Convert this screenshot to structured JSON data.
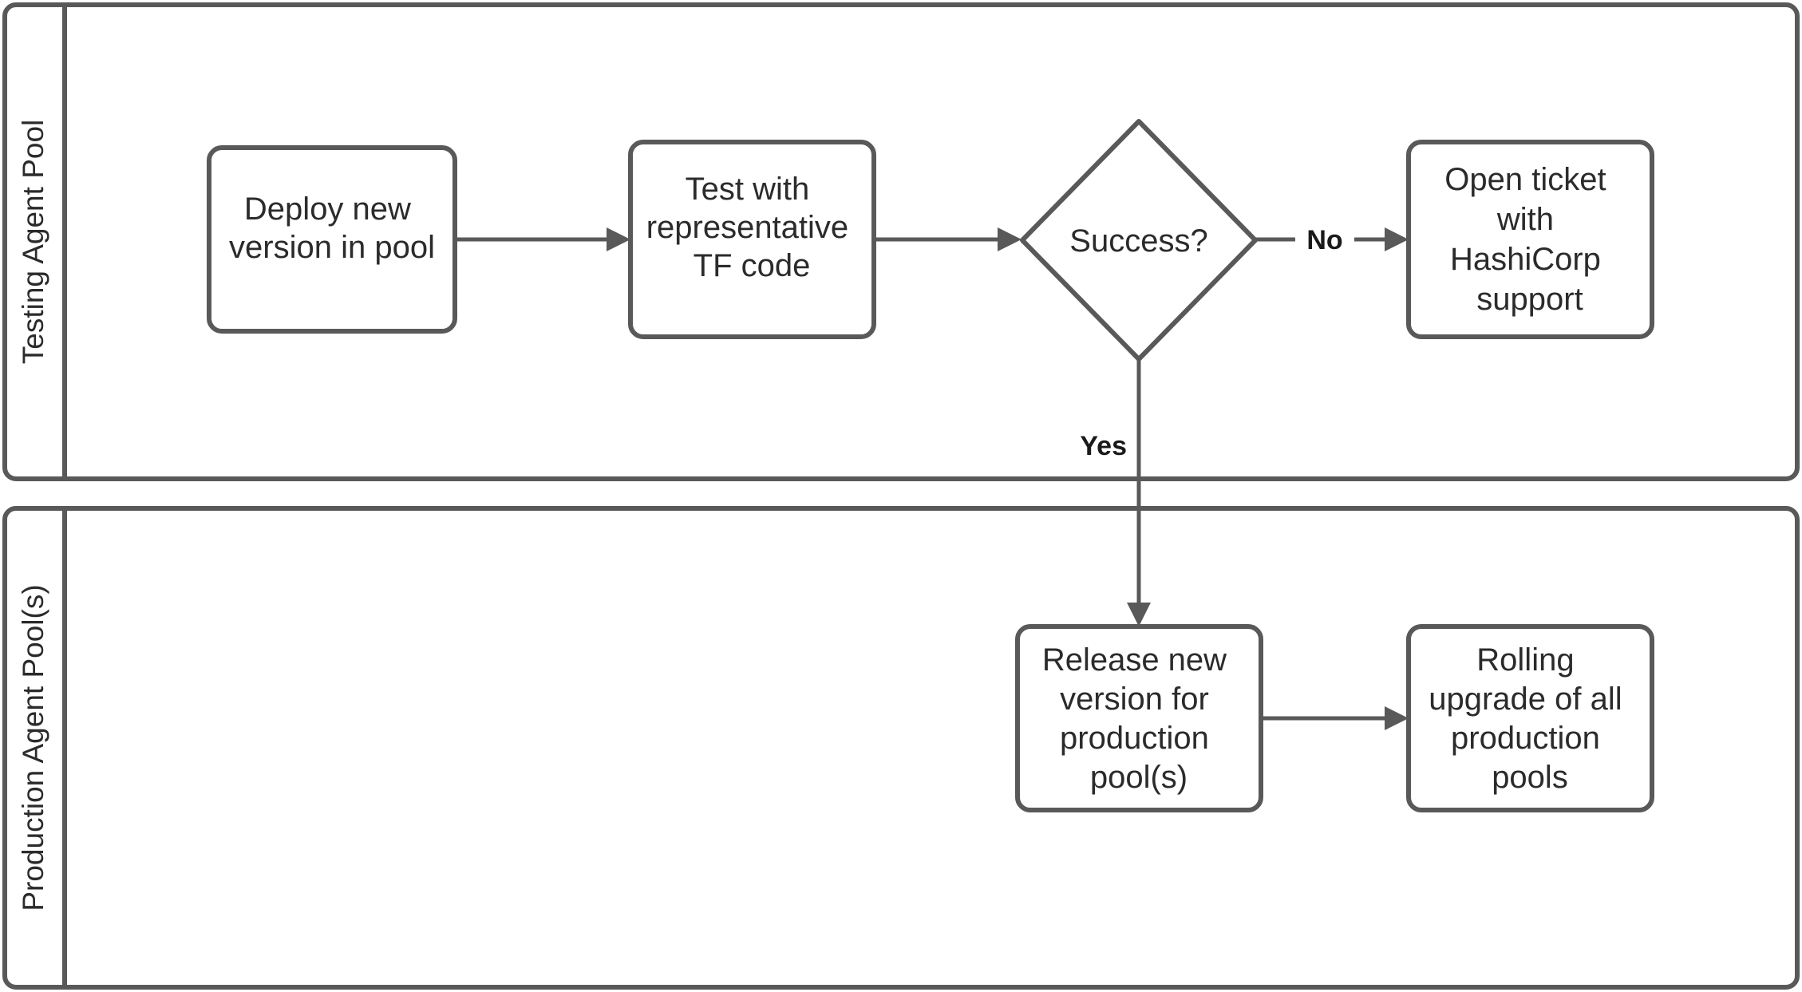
{
  "diagram": {
    "type": "swimlane-flowchart",
    "background": "#ffffff",
    "stroke_color": "#595959",
    "text_color": "#2b2b2b"
  },
  "lanes": [
    {
      "id": "testing",
      "title": "Testing Agent Pool"
    },
    {
      "id": "production",
      "title": "Production Agent Pool(s)"
    }
  ],
  "nodes": {
    "deploy": {
      "shape": "process",
      "lane": "testing",
      "lines": [
        "Deploy new",
        "version in pool"
      ]
    },
    "test": {
      "shape": "process",
      "lane": "testing",
      "lines": [
        "Test with",
        "representative",
        "TF code"
      ]
    },
    "success": {
      "shape": "decision",
      "lane": "testing",
      "lines": [
        "Success?"
      ]
    },
    "ticket": {
      "shape": "process",
      "lane": "testing",
      "lines": [
        "Open ticket",
        "with",
        "HashiCorp",
        "support"
      ]
    },
    "release": {
      "shape": "process",
      "lane": "production",
      "lines": [
        "Release new",
        "version for",
        "production",
        "pool(s)"
      ]
    },
    "rolling": {
      "shape": "process",
      "lane": "production",
      "lines": [
        "Rolling",
        "upgrade of all",
        "production",
        "pools"
      ]
    }
  },
  "edges": [
    {
      "id": "deploy-to-test",
      "from": "deploy",
      "to": "test",
      "label": ""
    },
    {
      "id": "test-to-success",
      "from": "test",
      "to": "success",
      "label": ""
    },
    {
      "id": "success-no-ticket",
      "from": "success",
      "to": "ticket",
      "label": "No"
    },
    {
      "id": "success-yes-release",
      "from": "success",
      "to": "release",
      "label": "Yes"
    },
    {
      "id": "release-to-rolling",
      "from": "release",
      "to": "rolling",
      "label": ""
    }
  ]
}
